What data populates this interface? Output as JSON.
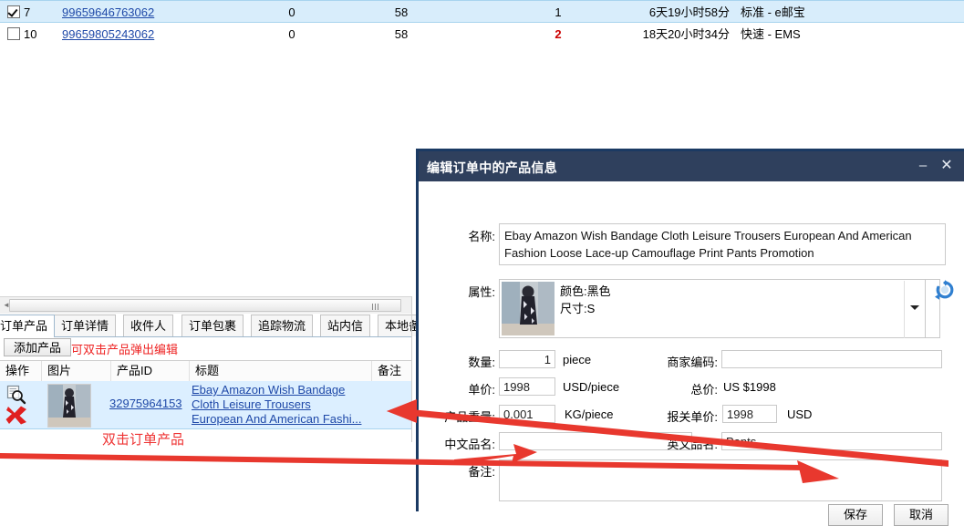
{
  "order_grid": {
    "rows": [
      {
        "checked": true,
        "num": "7",
        "tracking": "99659646763062",
        "col1": "0",
        "col2": "58",
        "col3": "1",
        "col3_alert": false,
        "remaining": "6天19小时58分",
        "shipping": "标准 - e邮宝"
      },
      {
        "checked": false,
        "num": "10",
        "tracking": "99659805243062",
        "col1": "0",
        "col2": "58",
        "col3": "2",
        "col3_alert": true,
        "remaining": "18天20小时34分",
        "shipping": "快速 - EMS"
      }
    ]
  },
  "left_panel": {
    "tabs": [
      {
        "label": "订单产品",
        "active": true
      },
      {
        "label": "订单详情",
        "active": false
      },
      {
        "label": "收件人",
        "active": false
      },
      {
        "label": "订单包裹",
        "active": false
      },
      {
        "label": "追踪物流",
        "active": false
      },
      {
        "label": "站内信",
        "active": false
      },
      {
        "label": "本地备注",
        "active": false
      }
    ],
    "add_product_label": "添加产品",
    "double_click_hint": "可双击产品弹出编辑",
    "product_headers": [
      "操作",
      "图片",
      "产品ID",
      "标题",
      "备注"
    ],
    "product_row": {
      "product_id": "32975964153",
      "title_lines": [
        "Ebay Amazon Wish Bandage",
        "Cloth Leisure Trousers",
        "European And American Fashi..."
      ]
    },
    "annotation_note": "双击订单产品"
  },
  "dialog": {
    "title": "编辑订单中的产品信息",
    "minimize_label": "–",
    "close_label": "✕",
    "fields": {
      "name_label": "名称:",
      "name_value": "Ebay Amazon Wish Bandage Cloth Leisure Trousers European And American Fashion Loose Lace-up Camouflage Print Pants Promotion",
      "attr_label": "属性:",
      "attr_color": "颜色:黑色",
      "attr_size": "尺寸:S",
      "qty_label": "数量:",
      "qty_value": "1",
      "qty_unit": "piece",
      "seller_code_label": "商家编码:",
      "seller_code_value": "",
      "unit_price_label": "单价:",
      "unit_price_value": "1998",
      "unit_price_unit": "USD/piece",
      "total_label": "总价:",
      "total_value": "US $1998",
      "weight_label": "产品重量:",
      "weight_value": "0.001",
      "weight_unit": "KG/piece",
      "declare_price_label": "报关单价:",
      "declare_price_value": "1998",
      "declare_price_unit": "USD",
      "cn_name_label": "中文品名:",
      "cn_name_value": "",
      "en_name_label": "英文品名:",
      "en_name_value": "Pants",
      "remark_label": "备注:",
      "remark_value": ""
    },
    "save_label": "保存",
    "cancel_label": "取消"
  },
  "colors": {
    "dialog_titlebar": "#2f405d",
    "dialog_border": "#1b3a63",
    "row_selected": "#d8edfb",
    "link": "#1f49a8",
    "alert_red": "#cc0000",
    "annotation_red": "#ee2222",
    "arrow_red": "#e8382e"
  }
}
